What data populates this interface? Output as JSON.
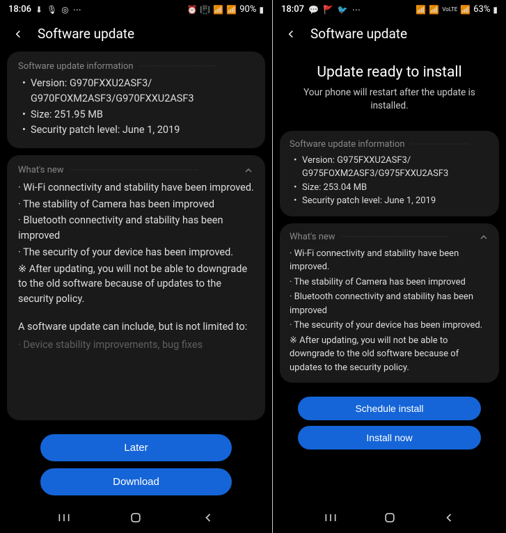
{
  "left": {
    "status": {
      "time": "18:06",
      "battery": "90%"
    },
    "title": "Software update",
    "info": {
      "header": "Software update information",
      "version_label": "Version:",
      "version": "G970FXXU2ASF3/ G970FOXM2ASF3/G970FXXU2ASF3",
      "size_label": "Size:",
      "size": "251.95 MB",
      "patch_label": "Security patch level:",
      "patch": "June 1, 2019"
    },
    "whatsnew": {
      "header": "What's new",
      "items": [
        "Wi-Fi connectivity and stability have been improved.",
        "The stability of Camera has been improved",
        "Bluetooth connectivity and stability has been improved",
        "The security of your device has been improved."
      ],
      "note": "※ After updating, you will not be able to downgrade to the old software because of updates to the security policy.",
      "extra": "A software update can include, but is not limited to:",
      "cutoff": "Device stability improvements, bug fixes"
    },
    "btn_later": "Later",
    "btn_download": "Download"
  },
  "right": {
    "status": {
      "time": "18:07",
      "battery": "63%"
    },
    "title": "Software update",
    "hero": {
      "title": "Update ready to install",
      "sub": "Your phone will restart after the update is installed."
    },
    "info": {
      "header": "Software update information",
      "version_label": "Version:",
      "version": "G975FXXU2ASF3/ G975FOXM2ASF3/G975FXXU2ASF3",
      "size_label": "Size:",
      "size": "253.04 MB",
      "patch_label": "Security patch level:",
      "patch": "June 1, 2019"
    },
    "whatsnew": {
      "header": "What's new",
      "items": [
        "Wi-Fi connectivity and stability have been improved.",
        "The stability of Camera has been improved",
        "Bluetooth connectivity and stability has been improved",
        "The security of your device has been improved."
      ],
      "note": "※ After updating, you will not be able to downgrade to the old software because of updates to the security policy."
    },
    "btn_schedule": "Schedule install",
    "btn_install": "Install now"
  }
}
